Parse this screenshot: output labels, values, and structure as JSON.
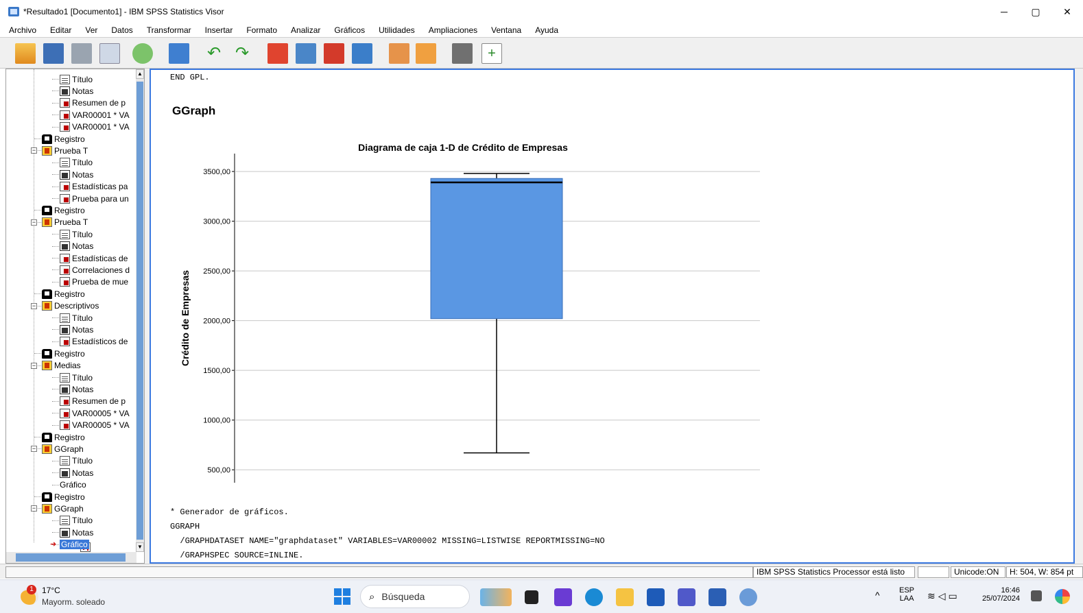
{
  "window": {
    "title": "*Resultado1 [Documento1] - IBM SPSS Statistics Visor",
    "minimize": "─",
    "maximize": "▢",
    "close": "✕"
  },
  "menu": [
    "Archivo",
    "Editar",
    "Ver",
    "Datos",
    "Transformar",
    "Insertar",
    "Formato",
    "Analizar",
    "Gráficos",
    "Utilidades",
    "Ampliaciones",
    "Ventana",
    "Ayuda"
  ],
  "toolbar": [
    "open-icon",
    "save-icon",
    "print-icon",
    "print-preview-icon",
    "export-icon",
    "recall-dialog-icon",
    "undo-icon",
    "redo-icon",
    "goto-data-icon",
    "goto-case-icon",
    "goto-variable-icon",
    "variables-icon",
    "insert-output-icon",
    "insert-chart-icon",
    "designate-window-icon",
    "add-icon"
  ],
  "tree": [
    {
      "label": "Título",
      "icon": "title",
      "level": 2
    },
    {
      "label": "Notas",
      "icon": "notes",
      "level": 2
    },
    {
      "label": "Resumen de p",
      "icon": "table",
      "level": 2
    },
    {
      "label": "VAR00001 * VA",
      "icon": "table",
      "level": 2
    },
    {
      "label": "VAR00001 * VA",
      "icon": "table",
      "level": 2
    },
    {
      "label": "Registro",
      "icon": "log",
      "level": 1
    },
    {
      "label": "Prueba T",
      "icon": "proc",
      "level": 1,
      "expander": "−"
    },
    {
      "label": "Título",
      "icon": "title",
      "level": 2
    },
    {
      "label": "Notas",
      "icon": "notes",
      "level": 2
    },
    {
      "label": "Estadísticas pa",
      "icon": "table",
      "level": 2
    },
    {
      "label": "Prueba para un",
      "icon": "table",
      "level": 2
    },
    {
      "label": "Registro",
      "icon": "log",
      "level": 1
    },
    {
      "label": "Prueba T",
      "icon": "proc",
      "level": 1,
      "expander": "−"
    },
    {
      "label": "Título",
      "icon": "title",
      "level": 2
    },
    {
      "label": "Notas",
      "icon": "notes",
      "level": 2
    },
    {
      "label": "Estadísticas de",
      "icon": "table",
      "level": 2
    },
    {
      "label": "Correlaciones d",
      "icon": "table",
      "level": 2
    },
    {
      "label": "Prueba de mue",
      "icon": "table",
      "level": 2
    },
    {
      "label": "Registro",
      "icon": "log",
      "level": 1
    },
    {
      "label": "Descriptivos",
      "icon": "proc",
      "level": 1,
      "expander": "−"
    },
    {
      "label": "Título",
      "icon": "title",
      "level": 2
    },
    {
      "label": "Notas",
      "icon": "notes",
      "level": 2
    },
    {
      "label": "Estadísticos de",
      "icon": "table",
      "level": 2
    },
    {
      "label": "Registro",
      "icon": "log",
      "level": 1
    },
    {
      "label": "Medias",
      "icon": "proc",
      "level": 1,
      "expander": "−"
    },
    {
      "label": "Título",
      "icon": "title",
      "level": 2
    },
    {
      "label": "Notas",
      "icon": "notes",
      "level": 2
    },
    {
      "label": "Resumen de p",
      "icon": "table",
      "level": 2
    },
    {
      "label": "VAR00005 * VA",
      "icon": "table",
      "level": 2
    },
    {
      "label": "VAR00005 * VA",
      "icon": "table",
      "level": 2
    },
    {
      "label": "Registro",
      "icon": "log",
      "level": 1
    },
    {
      "label": "GGraph",
      "icon": "proc",
      "level": 1,
      "expander": "−"
    },
    {
      "label": "Título",
      "icon": "title",
      "level": 2
    },
    {
      "label": "Notas",
      "icon": "notes",
      "level": 2
    },
    {
      "label": "Gráfico",
      "icon": "chart",
      "level": 2
    },
    {
      "label": "Registro",
      "icon": "log",
      "level": 1
    },
    {
      "label": "GGraph",
      "icon": "proc",
      "level": 1,
      "expander": "−"
    },
    {
      "label": "Título",
      "icon": "title",
      "level": 2
    },
    {
      "label": "Notas",
      "icon": "notes",
      "level": 2
    },
    {
      "label": "Gráfico",
      "icon": "chart",
      "level": 2,
      "selected": true
    }
  ],
  "output": {
    "end_gpl": "END GPL.",
    "heading": "GGraph",
    "syntax": [
      "* Generador de gráficos.",
      "GGRAPH",
      "  /GRAPHDATASET NAME=\"graphdataset\" VARIABLES=VAR00002 MISSING=LISTWISE REPORTMISSING=NO",
      "  /GRAPHSPEC SOURCE=INLINE."
    ]
  },
  "chart_data": {
    "type": "box",
    "title": "Diagrama de caja 1-D de Crédito de Empresas",
    "ylabel": "Crédito de Empresas",
    "ylim": [
      370,
      3680
    ],
    "yticks": [
      500,
      1000,
      1500,
      2000,
      2500,
      3000,
      3500
    ],
    "yticklabels": [
      "500,00",
      "1000,00",
      "1500,00",
      "2000,00",
      "2500,00",
      "3000,00",
      "3500,00"
    ],
    "grid": true,
    "box": {
      "min": 670,
      "q1": 2020,
      "median": 3390,
      "q3": 3430,
      "max": 3480
    },
    "color": "#5a97e3"
  },
  "status": {
    "processor": "IBM SPSS Statistics Processor está listo",
    "unicode": "Unicode:ON",
    "dims": "H: 504, W: 854 pt"
  },
  "taskbar": {
    "weather_temp": "17°C",
    "weather_desc": "Mayorm. soleado",
    "weather_badge": "1",
    "search": "Búsqueda",
    "lang": "ESP",
    "lang2": "LAA",
    "time": "16:46",
    "date": "25/07/2024"
  }
}
